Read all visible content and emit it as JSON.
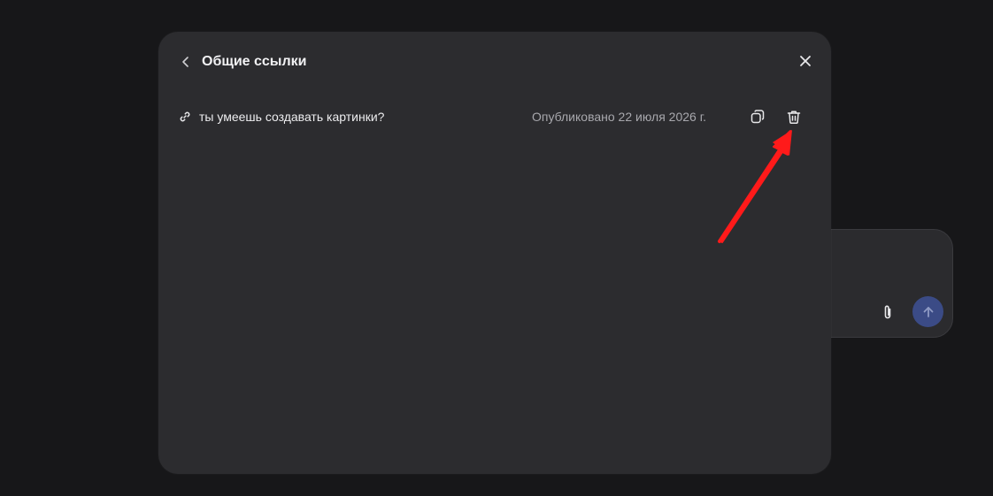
{
  "modal": {
    "title": "Общие ссылки",
    "links": [
      {
        "title": "ты умеешь создавать картинки?",
        "date": "Опубликовано 22 июля 2026 г."
      }
    ]
  },
  "icons": {
    "back": "chevron-left-icon",
    "close": "close-icon",
    "link": "link-icon",
    "copy": "copy-icon",
    "delete": "trash-icon",
    "attach": "paperclip-icon",
    "send": "arrow-up-icon"
  },
  "colors": {
    "background": "#171719",
    "modal": "#2c2c2f",
    "send_button": "#3b4b86",
    "annotation": "#ff1a1a"
  }
}
